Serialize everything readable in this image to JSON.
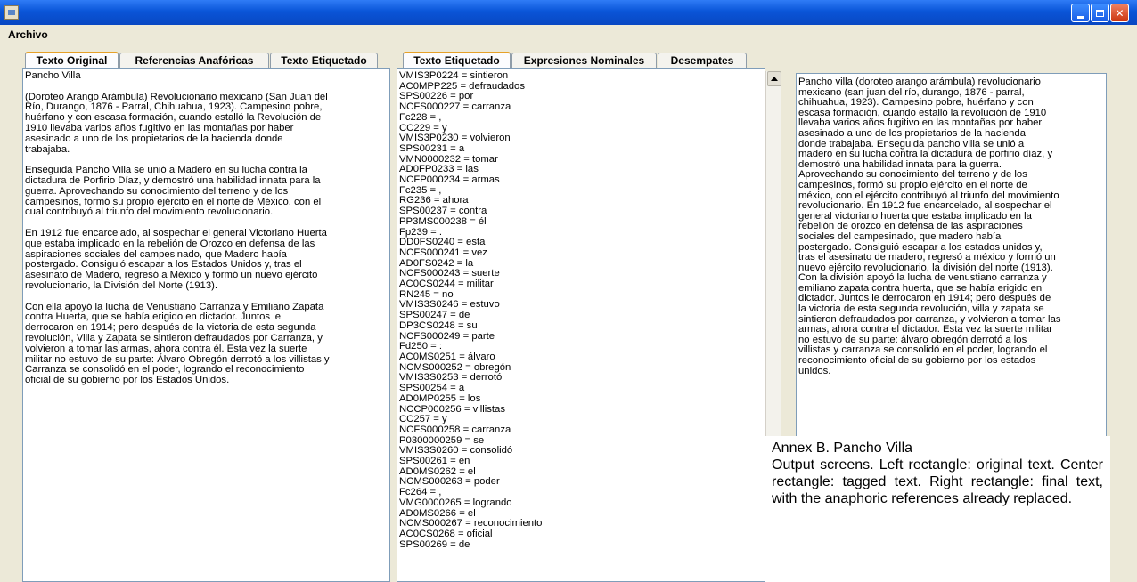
{
  "window": {
    "title": ""
  },
  "menu": {
    "archivo": "Archivo"
  },
  "left_tabs": [
    {
      "label": "Texto Original",
      "active": true
    },
    {
      "label": "Referencias Anafóricas",
      "active": false
    },
    {
      "label": "Texto Etiquetado",
      "active": false
    }
  ],
  "center_tabs": [
    {
      "label": "Texto Etiquetado",
      "active": true
    },
    {
      "label": "Expresiones Nominales",
      "active": false
    },
    {
      "label": "Desempates",
      "active": false
    }
  ],
  "original_text": "Pancho Villa\n\n(Doroteo Arango Arámbula) Revolucionario mexicano (San Juan del\nRío, Durango, 1876 - Parral, Chihuahua, 1923). Campesino pobre,\nhuérfano y con escasa formación, cuando estalló la Revolución de\n1910 llevaba varios años fugitivo en las montañas por haber\nasesinado a uno de los propietarios de la hacienda donde\ntrabajaba.\n\nEnseguida Pancho Villa se unió a Madero en su lucha contra la\ndictadura de Porfirio Díaz, y demostró una habilidad innata para la\nguerra. Aprovechando su conocimiento del terreno y de los\ncampesinos, formó su propio ejército en el norte de México, con el\ncual contribuyó al triunfo del movimiento revolucionario.\n\nEn 1912 fue encarcelado, al sospechar el general Victoriano Huerta\nque estaba implicado en la rebelión de Orozco en defensa de las\naspiraciones sociales del campesinado, que Madero había\npostergado. Consiguió escapar a los Estados Unidos y, tras el\nasesinato de Madero, regresó a México y formó un nuevo ejército\nrevolucionario, la División del Norte (1913).\n\nCon ella apoyó la lucha de Venustiano Carranza y Emiliano Zapata\ncontra Huerta, que se había erigido en dictador. Juntos le\nderrocaron en 1914; pero después de la victoria de esta segunda\nrevolución, Villa y Zapata se sintieron defraudados por Carranza, y\nvolvieron a tomar las armas, ahora contra él. Esta vez la suerte\nmilitar no estuvo de su parte: Álvaro Obregón derrotó a los villistas y\nCarranza se consolidó en el poder, logrando el reconocimiento\noficial de su gobierno por los Estados Unidos.",
  "tagged_text": "VMIS3P0224 = sintieron\nAC0MPP225 = defraudados\nSPS00226 = por\nNCFS000227 = carranza\nFc228 = ,\nCC229 = y\nVMIS3P0230 = volvieron\nSPS00231 = a\nVMN0000232 = tomar\nAD0FP0233 = las\nNCFP000234 = armas\nFc235 = ,\nRG236 = ahora\nSPS00237 = contra\nPP3MS000238 = él\nFp239 = .\nDD0FS0240 = esta\nNCFS000241 = vez\nAD0FS0242 = la\nNCFS000243 = suerte\nAC0CS0244 = militar\nRN245 = no\nVMIS3S0246 = estuvo\nSPS00247 = de\nDP3CS0248 = su\nNCFS000249 = parte\nFd250 = :\nAC0MS0251 = álvaro\nNCMS000252 = obregón\nVMIS3S0253 = derrotó\nSPS00254 = a\nAD0MP0255 = los\nNCCP000256 = villistas\nCC257 = y\nNCFS000258 = carranza\nP0300000259 = se\nVMIS3S0260 = consolidó\nSPS00261 = en\nAD0MS0262 = el\nNCMS000263 = poder\nFc264 = ,\nVMG0000265 = logrando\nAD0MS0266 = el\nNCMS000267 = reconocimiento\nAC0CS0268 = oficial\nSPS00269 = de",
  "final_text": "Pancho villa (doroteo arango arámbula) revolucionario\nmexicano (san juan del río, durango, 1876 - parral,\nchihuahua, 1923). Campesino pobre, huérfano y con\nescasa formación, cuando estalló la revolución de 1910\nllevaba varios años fugitivo en las montañas por haber\nasesinado a uno de los propietarios de la hacienda\ndonde trabajaba. Enseguida pancho villa se unió a\nmadero en su lucha contra la dictadura de porfirio díaz, y\ndemostró una habilidad innata para la guerra.\nAprovechando su conocimiento del terreno y de los\ncampesinos, formó su propio ejército en el norte de\nméxico, con el ejército contribuyó al triunfo del movimiento\nrevolucionario. En 1912 fue encarcelado, al sospechar el\ngeneral victoriano huerta que estaba implicado en la\nrebelión de orozco en defensa de las aspiraciones\nsociales del campesinado, que madero había\npostergado. Consiguió escapar a los estados unidos y,\ntras el asesinato de madero, regresó a méxico y formó un\nnuevo ejército revolucionario, la división del norte (1913).\nCon la división apoyó la lucha de venustiano carranza y\nemiliano zapata contra huerta, que se había erigido en\ndictador. Juntos le derrocaron en 1914; pero después de\nla victoria de esta segunda revolución, villa y zapata se\nsintieron defraudados por carranza, y volvieron a tomar las\narmas, ahora contra el dictador. Esta vez la suerte militar\nno estuvo de su parte: álvaro obregón derrotó a los\nvillistas y carranza se consolidó en el poder, logrando el\nreconocimiento oficial de su gobierno por los estados\nunidos.",
  "annex": {
    "title": "Annex B. Pancho Villa",
    "caption": "Output screens. Left rectangle: original text. Center rectangle: tagged text. Right rectangle: final text, with the anaphoric references already replaced."
  },
  "icons": {
    "app": "java-cup-icon",
    "minimize": "minimize-icon",
    "maximize": "maximize-icon",
    "close": "close-icon",
    "scroll_up": "arrow-up-icon"
  },
  "colors": {
    "titlebar": "#0a55d8",
    "active_tab_accent": "#e6a128",
    "panel_border": "#7f9db9",
    "window_bg": "#ece9d8"
  }
}
